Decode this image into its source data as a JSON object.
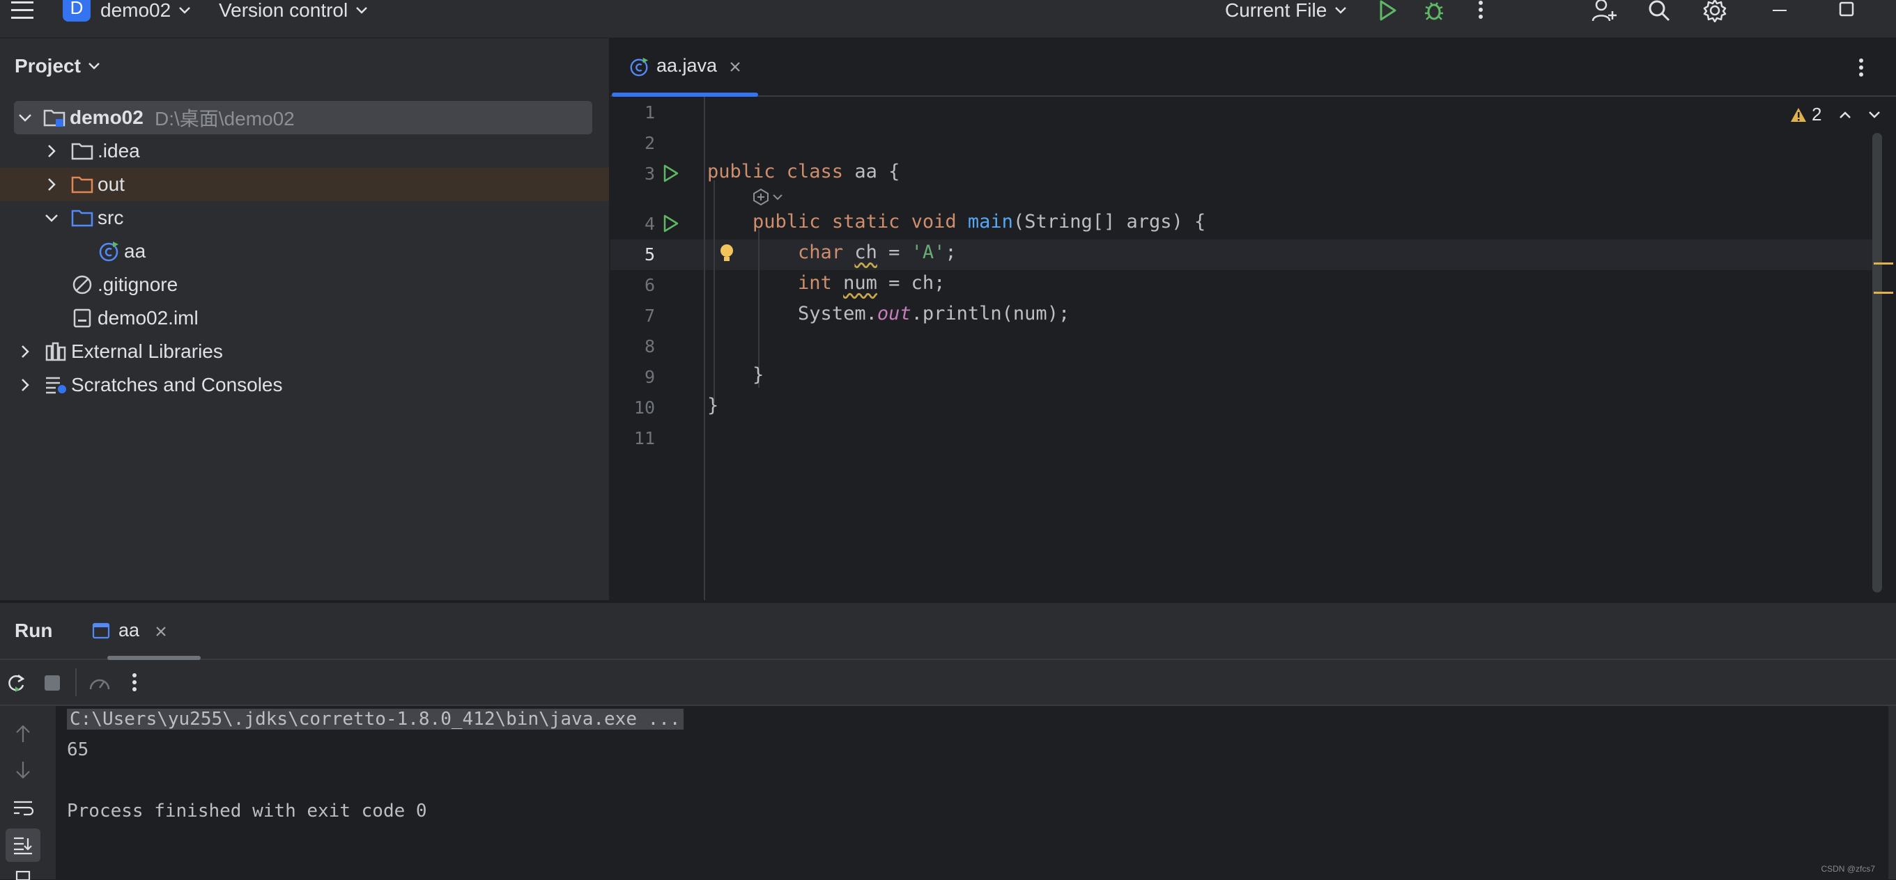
{
  "titlebar": {
    "project_badge": "D",
    "project_name": "demo02",
    "vcs_menu": "Version control",
    "run_config": "Current File"
  },
  "project_panel": {
    "title": "Project",
    "tree": {
      "root_name": "demo02",
      "root_path": "D:\\桌面\\demo02",
      "idea": ".idea",
      "out": "out",
      "src": "src",
      "aa": "aa",
      "gitignore": ".gitignore",
      "iml": "demo02.iml",
      "external_libraries": "External Libraries",
      "scratches": "Scratches and Consoles"
    }
  },
  "editor": {
    "tab_label": "aa.java",
    "warning_count": "2",
    "line_numbers": [
      "1",
      "2",
      "3",
      "4",
      "5",
      "6",
      "7",
      "8",
      "9",
      "10",
      "11"
    ],
    "code": {
      "l3_kw": "public class",
      "l3_rest": " aa {",
      "l4_kw": "public static void",
      "l4_fn": "main",
      "l4_rest": "(String[] args) {",
      "l5_kw": "char",
      "l5_var": "ch",
      "l5_eq": " = ",
      "l5_str": "'A'",
      "l5_end": ";",
      "l6_kw": "int",
      "l6_var": "num",
      "l6_rest": " = ch;",
      "l7_a": "System.",
      "l7_fld": "out",
      "l7_b": ".println(num);",
      "l9": "}",
      "l10": "}"
    }
  },
  "run_panel": {
    "title": "Run",
    "tab_label": "aa",
    "console": {
      "command": "C:\\Users\\yu255\\.jdks\\corretto-1.8.0_412\\bin\\java.exe ...",
      "output": "65",
      "exit_message": "Process finished with exit code 0"
    },
    "watermark": "CSDN @zfcs7"
  },
  "colors": {
    "accent": "#3574f0",
    "run_green": "#5fb865",
    "warning": "#e0b24d",
    "background": "#1e1f22",
    "panel": "#2b2d30"
  }
}
